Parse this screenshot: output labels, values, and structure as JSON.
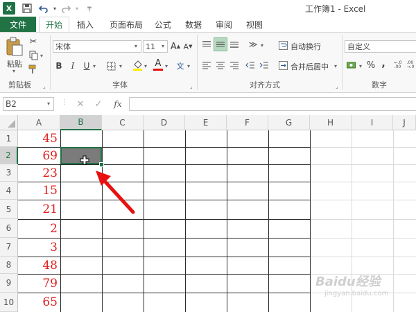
{
  "window": {
    "title": "工作簿1 - Excel",
    "app_icon": "X"
  },
  "tabs": [
    {
      "label": "文件"
    },
    {
      "label": "开始"
    },
    {
      "label": "插入"
    },
    {
      "label": "页面布局"
    },
    {
      "label": "公式"
    },
    {
      "label": "数据"
    },
    {
      "label": "审阅"
    },
    {
      "label": "视图"
    }
  ],
  "ribbon": {
    "clipboard": {
      "label": "剪贴板",
      "paste": "粘贴"
    },
    "font": {
      "label": "字体",
      "name": "宋体",
      "size": "11",
      "bold": "B",
      "italic": "I",
      "underline": "U",
      "wen": "文",
      "grow": "A",
      "shrink": "A",
      "font_color": "A"
    },
    "align": {
      "label": "对齐方式",
      "wrap": "自动换行",
      "merge": "合并后居中"
    },
    "number": {
      "label": "数字",
      "format": "自定义",
      "percent": "%",
      "comma": ","
    }
  },
  "formula_bar": {
    "name_box": "B2",
    "fx": "fx",
    "value": ""
  },
  "sheet": {
    "columns": [
      "A",
      "B",
      "C",
      "D",
      "E",
      "F",
      "G",
      "H",
      "I",
      "J"
    ],
    "rows": [
      "1",
      "2",
      "3",
      "4",
      "5",
      "6",
      "7",
      "8",
      "9",
      "10"
    ],
    "colA": [
      "45",
      "69",
      "23",
      "15",
      "21",
      "2",
      "3",
      "48",
      "79",
      "65"
    ],
    "active_cell": "B2"
  },
  "watermark": {
    "text": "Baidu经验",
    "sub": "jingyan.baidu.com"
  },
  "colors": {
    "accent": "#217346",
    "value_red": "#e02020",
    "arrow_red": "#e81010",
    "selected_fill": "#7b7b7b"
  }
}
